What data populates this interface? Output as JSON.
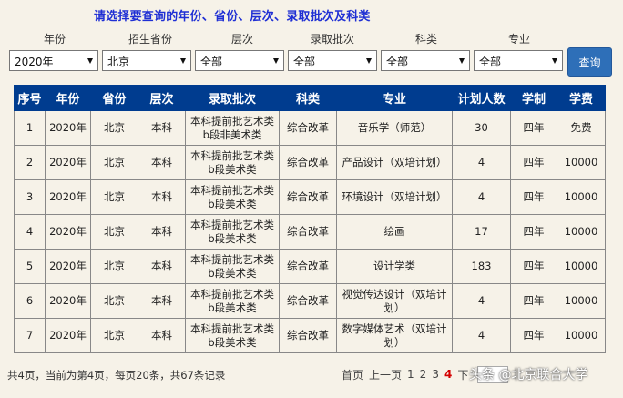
{
  "title": "请选择要查询的年份、省份、层次、录取批次及科类",
  "filters": {
    "labels": [
      "年份",
      "招生省份",
      "层次",
      "录取批次",
      "科类",
      "专业"
    ],
    "values": [
      "2020年",
      "北京",
      "全部",
      "全部",
      "全部",
      "全部"
    ]
  },
  "query_button": "查询",
  "table": {
    "headers": [
      "序号",
      "年份",
      "省份",
      "层次",
      "录取批次",
      "科类",
      "专业",
      "计划人数",
      "学制",
      "学费"
    ],
    "rows": [
      [
        "1",
        "2020年",
        "北京",
        "本科",
        "本科提前批艺术类b段非美术类",
        "综合改革",
        "音乐学（师范）",
        "30",
        "四年",
        "免费"
      ],
      [
        "2",
        "2020年",
        "北京",
        "本科",
        "本科提前批艺术类b段美术类",
        "综合改革",
        "产品设计（双培计划）",
        "4",
        "四年",
        "10000"
      ],
      [
        "3",
        "2020年",
        "北京",
        "本科",
        "本科提前批艺术类b段美术类",
        "综合改革",
        "环境设计（双培计划）",
        "4",
        "四年",
        "10000"
      ],
      [
        "4",
        "2020年",
        "北京",
        "本科",
        "本科提前批艺术类b段美术类",
        "综合改革",
        "绘画",
        "17",
        "四年",
        "10000"
      ],
      [
        "5",
        "2020年",
        "北京",
        "本科",
        "本科提前批艺术类b段美术类",
        "综合改革",
        "设计学类",
        "183",
        "四年",
        "10000"
      ],
      [
        "6",
        "2020年",
        "北京",
        "本科",
        "本科提前批艺术类b段美术类",
        "综合改革",
        "视觉传达设计（双培计划）",
        "4",
        "四年",
        "10000"
      ],
      [
        "7",
        "2020年",
        "北京",
        "本科",
        "本科提前批艺术类b段美术类",
        "综合改革",
        "数字媒体艺术（双培计划）",
        "4",
        "四年",
        "10000"
      ]
    ]
  },
  "footer": {
    "summary": "共4页，当前为第4页，每页20条，共67条记录",
    "first": "首页",
    "prev": "上一页",
    "pages": [
      "1",
      "2",
      "3",
      "4"
    ],
    "current_page": "4",
    "next": "下"
  },
  "watermark": "头条 @北京联合大学"
}
